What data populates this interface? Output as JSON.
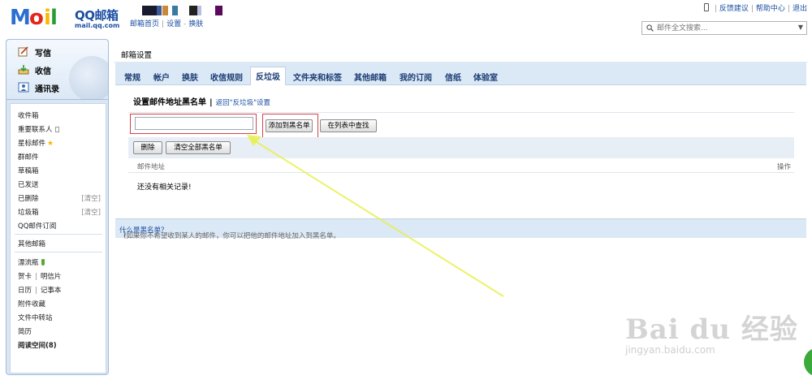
{
  "header": {
    "logo": {
      "letters": [
        "M",
        "o",
        "i",
        "l"
      ],
      "colors": [
        "#2b6fd1",
        "#e4261c",
        "#fbb800",
        "#2f9a35"
      ]
    },
    "brand": "QQ邮箱",
    "brand_url": "mail.qq.com",
    "sub_links": [
      "邮箱首页",
      "设置",
      "换肤"
    ],
    "top_links": [
      "反馈建议",
      "帮助中心",
      "退出"
    ],
    "search": {
      "placeholder": "邮件全文搜索..."
    }
  },
  "sidebar": {
    "actions": [
      {
        "label": "写信",
        "icon": "compose-icon"
      },
      {
        "label": "收信",
        "icon": "inbox-download-icon"
      },
      {
        "label": "通讯录",
        "icon": "contacts-icon"
      }
    ],
    "folders": {
      "inbox": "收件箱",
      "vip": "重要联系人",
      "starred": "星标邮件",
      "group": "群邮件",
      "drafts": "草稿箱",
      "sent": "已发送",
      "deleted": "已删除",
      "deleted_clear": "[清空]",
      "spam": "垃圾箱",
      "spam_clear": "[清空]",
      "subscription": "QQ邮件订阅",
      "other": "其他邮箱",
      "drift_bottle": "漂流瓶",
      "card": "贺卡",
      "postcard": "明信片",
      "calendar": "日历",
      "notebook": "记事本",
      "attachments": "附件收藏",
      "transfer": "文件中转站",
      "resume": "简历",
      "reading": "阅读空间(8)"
    }
  },
  "main": {
    "title": "邮箱设置",
    "tabs": [
      "常规",
      "帐户",
      "换肤",
      "收信规则",
      "反垃圾",
      "文件夹和标签",
      "其他邮箱",
      "我的订阅",
      "信纸",
      "体验室"
    ],
    "active_tab": "反垃圾",
    "section_title": "设置邮件地址黑名单",
    "section_sep": "|",
    "back_link": "返回\"反垃圾\"设置",
    "email_input": {
      "value": "",
      "placeholder": ""
    },
    "add_button": "添加到黑名单",
    "find_button": "在列表中查找",
    "delete_button": "删除",
    "clear_button": "清空全部黑名单",
    "col_email": "邮件地址",
    "col_ops": "操作",
    "empty_message": "还没有相关记录!",
    "footer_note_prefix": "(如果你不希望收到某人的邮件，你可以把他的邮件地址加入到黑名单。",
    "footer_note_link": "什么是黑名单？",
    "footer_note_suffix": ")"
  },
  "watermark": {
    "text": "Bai du 经验",
    "url": "jingyan.baidu.com"
  },
  "colors": {
    "accent": "#1b4ea3",
    "tab_bar": "#dbe8f6",
    "highlight": "#d2454a",
    "annotation_arrow": "#e8f04a"
  }
}
